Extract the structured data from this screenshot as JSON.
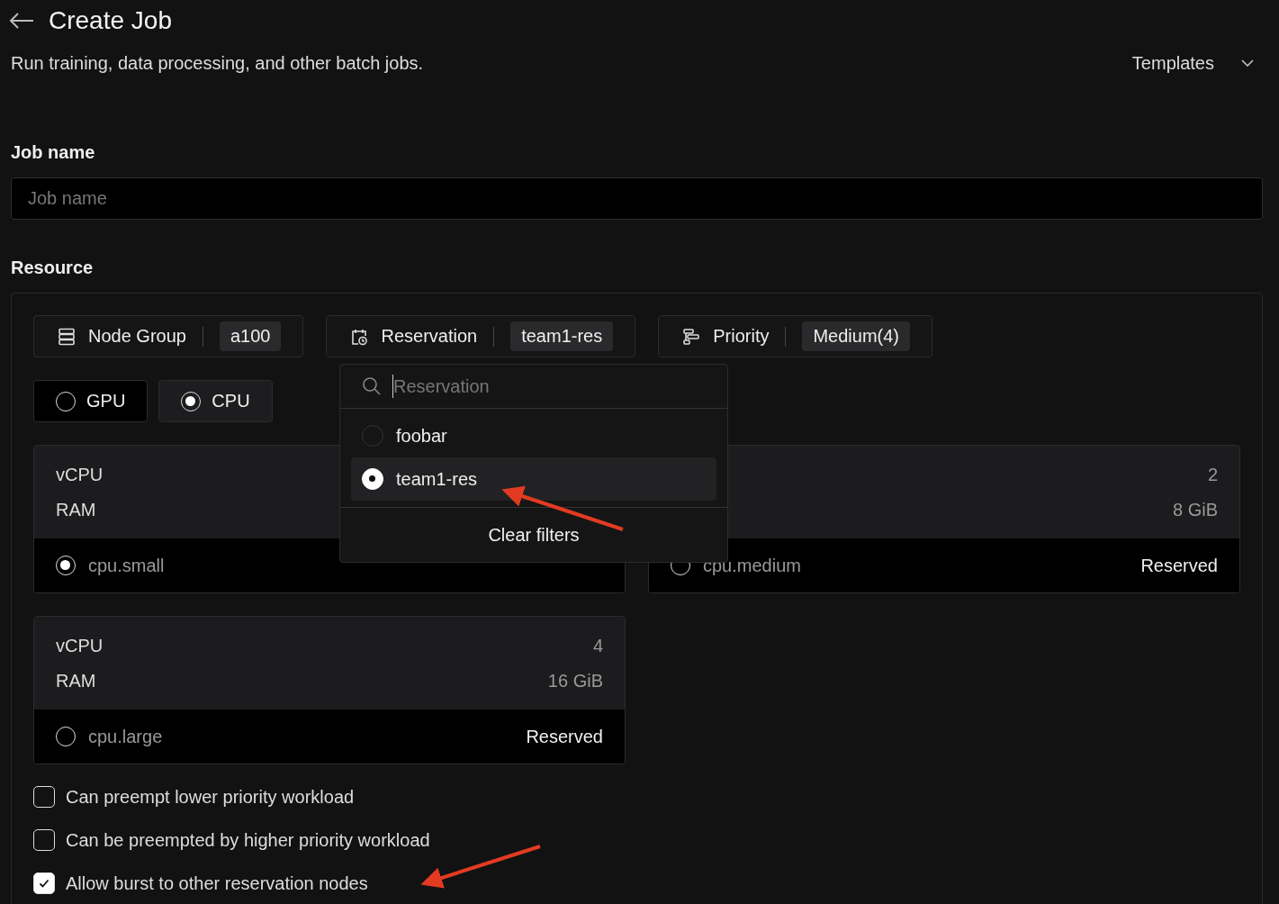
{
  "header": {
    "title": "Create Job",
    "subtitle": "Run training, data processing, and other batch jobs.",
    "templates": "Templates"
  },
  "job_name": {
    "label": "Job name",
    "placeholder": "Job name"
  },
  "resource": {
    "label": "Resource",
    "filters": [
      {
        "label": "Node Group",
        "value": "a100"
      },
      {
        "label": "Reservation",
        "value": "team1-res"
      },
      {
        "label": "Priority",
        "value": "Medium(4)"
      }
    ],
    "types": [
      {
        "label": "GPU",
        "selected": false
      },
      {
        "label": "CPU",
        "selected": true
      }
    ],
    "cards": [
      {
        "vcpu_label": "vCPU",
        "ram_label": "RAM",
        "name": "cpu.small",
        "selected": true
      },
      {
        "vcpu_value": "2",
        "ram_value": "8 GiB",
        "name": "cpu.medium",
        "status": "Reserved",
        "selected": false
      },
      {
        "vcpu_label": "vCPU",
        "ram_label": "RAM",
        "vcpu_value": "4",
        "ram_value": "16 GiB",
        "name": "cpu.large",
        "status": "Reserved",
        "selected": false
      }
    ],
    "dropdown": {
      "placeholder": "Reservation",
      "options": [
        {
          "label": "foobar",
          "selected": false
        },
        {
          "label": "team1-res",
          "selected": true
        }
      ],
      "clear": "Clear filters"
    },
    "options": [
      {
        "label": "Can preempt lower priority workload",
        "checked": false
      },
      {
        "label": "Can be preempted by higher priority workload",
        "checked": false
      },
      {
        "label": "Allow burst to other reservation nodes",
        "checked": true
      }
    ]
  }
}
